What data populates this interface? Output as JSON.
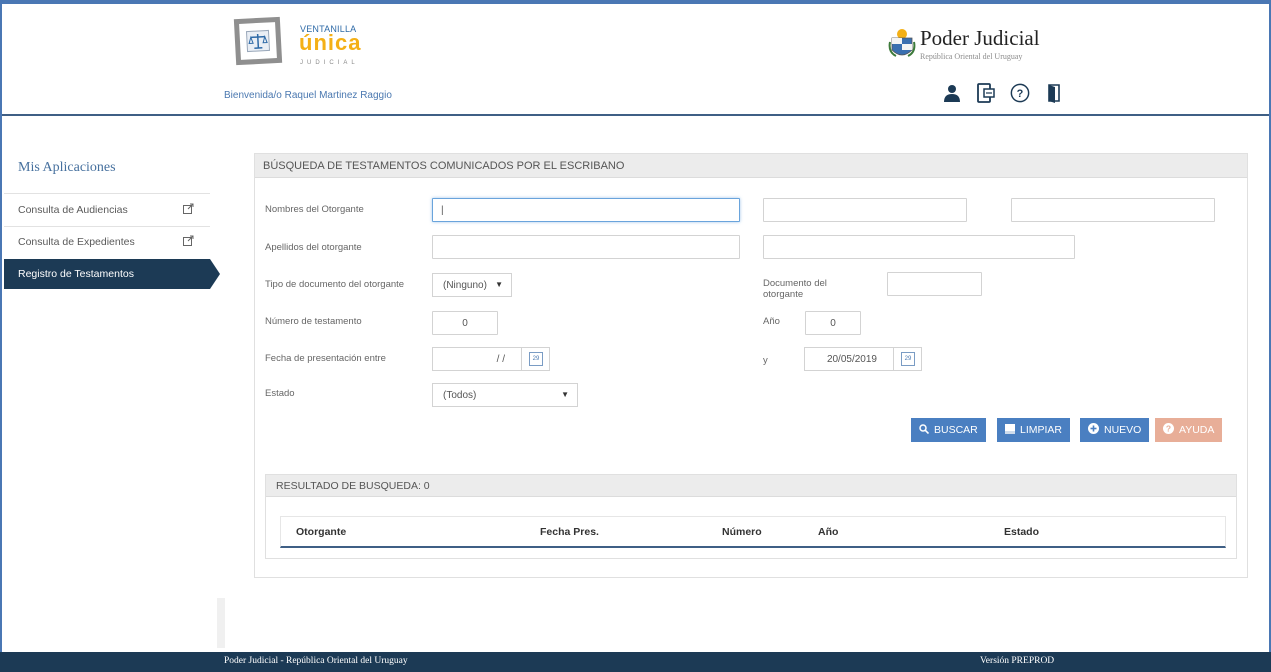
{
  "header": {
    "logo_line1": "VENTANILLA",
    "logo_line2": "única",
    "logo_line3": "JUDICIAL",
    "welcome": "Bienvenida/o Raquel Martinez Raggio",
    "pj_title": "Poder Judicial",
    "pj_subtitle": "República Oriental del Uruguay",
    "icons": [
      "user-icon",
      "mobile-icon",
      "help-icon",
      "logout-icon"
    ]
  },
  "sidebar": {
    "title": "Mis Aplicaciones",
    "items": [
      {
        "label": "Consulta de Audiencias",
        "icon": "external-link-icon",
        "active": false
      },
      {
        "label": "Consulta de Expedientes",
        "icon": "external-link-icon",
        "active": false
      },
      {
        "label": "Registro de Testamentos",
        "active": true
      }
    ]
  },
  "search": {
    "title": "BÚSQUEDA DE TESTAMENTOS COMUNICADOS POR EL ESCRIBANO",
    "nombres_label": "Nombres del Otorgante",
    "nombres_value": "|",
    "apellidos_label": "Apellidos del otorgante",
    "tipo_doc_label": "Tipo de documento del otorgante",
    "tipo_doc_value": "(Ninguno)",
    "documento_label_1": "Documento del",
    "documento_label_2": "otorgante",
    "numero_label": "Número de testamento",
    "numero_value": "0",
    "anio_label": "Año",
    "anio_value": "0",
    "fecha_label": "Fecha de presentación entre",
    "fecha_desde": "/ /",
    "y_label": "y",
    "fecha_hasta": "20/05/2019",
    "estado_label": "Estado",
    "estado_value": "(Todos)",
    "calendar_glyph": "29"
  },
  "buttons": {
    "buscar": "BUSCAR",
    "limpiar": "LIMPIAR",
    "nuevo": "NUEVO",
    "ayuda": "AYUDA"
  },
  "colors": {
    "primary": "#4a7fc1",
    "dark_navy": "#1c3a55",
    "help_button": "#e8ae98",
    "logo_yellow": "#f4b016"
  },
  "results": {
    "title": "RESULTADO DE BUSQUEDA: 0",
    "columns": [
      "Otorgante",
      "Fecha Pres.",
      "Número",
      "Año",
      "Estado"
    ]
  },
  "footer": {
    "left": "Poder Judicial - República Oriental del Uruguay",
    "right": "Versión PREPROD"
  }
}
